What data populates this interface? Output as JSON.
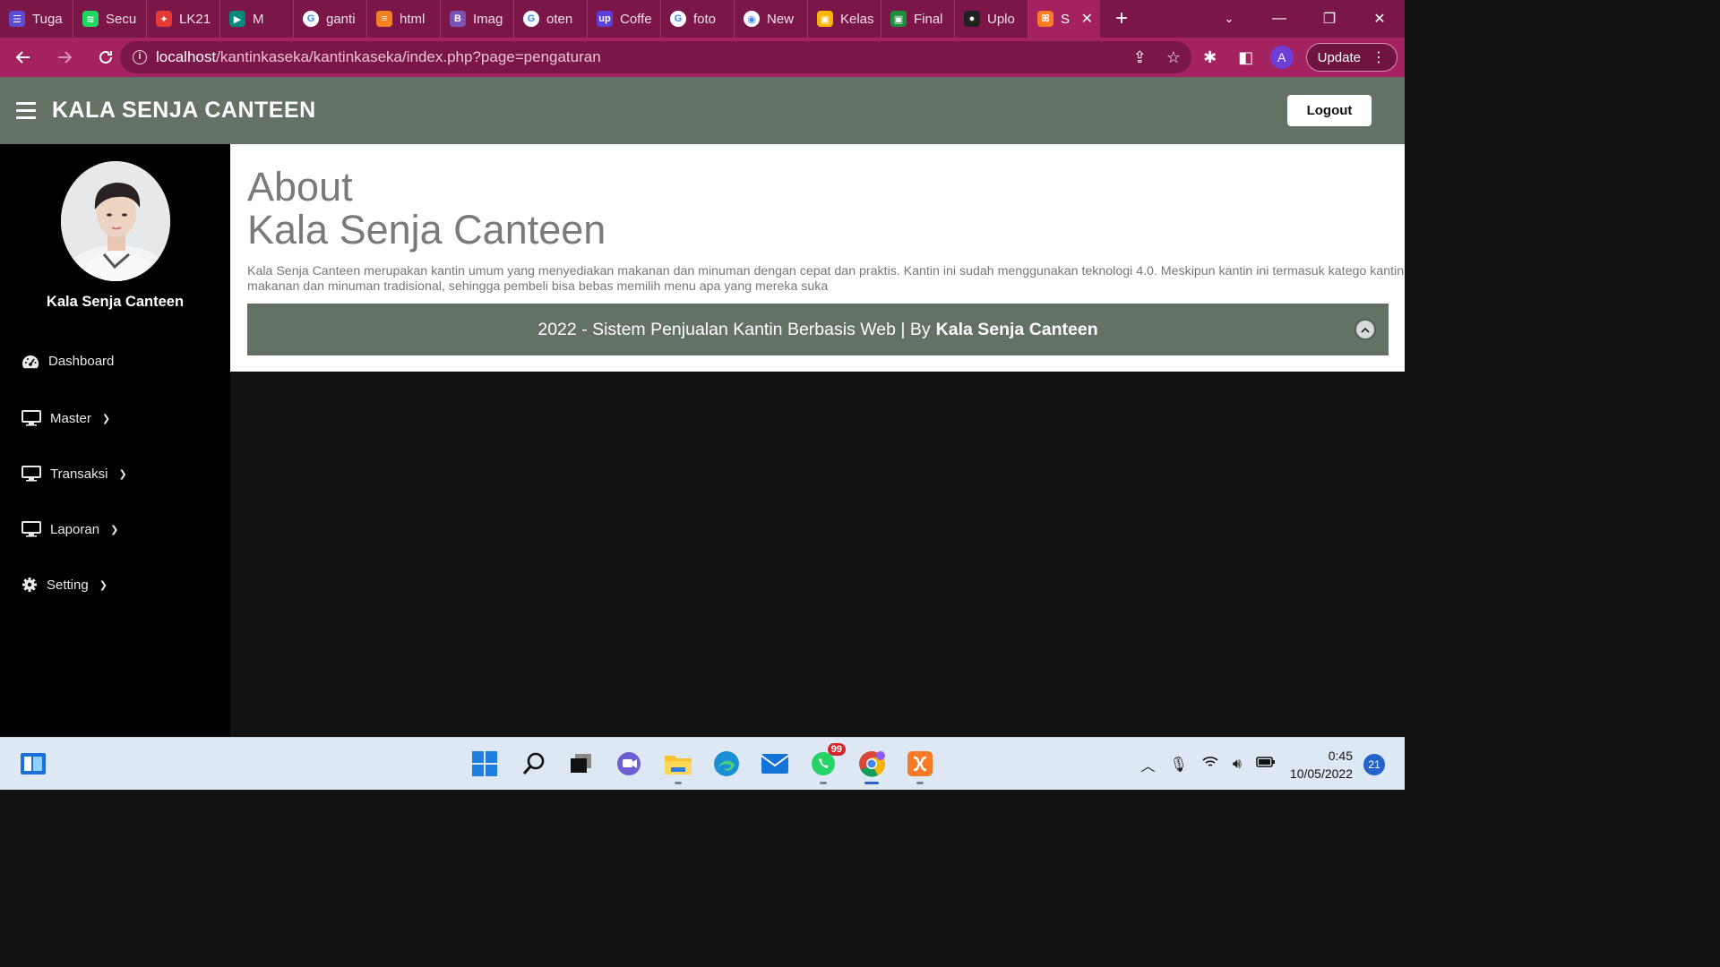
{
  "browser": {
    "tabs": [
      {
        "label": "Tuga",
        "icon": "tasks-icon",
        "color": "#5a4bd1",
        "glyph": "☰"
      },
      {
        "label": "Secu",
        "icon": "spotify-icon",
        "color": "#1ed760",
        "glyph": "≋"
      },
      {
        "label": "LK21",
        "icon": "pinwheel-icon",
        "color": "#e53935",
        "glyph": "✦"
      },
      {
        "label": "M",
        "icon": "meet-icon",
        "color": "#00897b",
        "glyph": "▶"
      },
      {
        "label": "ganti",
        "icon": "google-icon",
        "color": "#ffffff",
        "glyph": "G"
      },
      {
        "label": "html",
        "icon": "stackoverflow-icon",
        "color": "#f48024",
        "glyph": "≡"
      },
      {
        "label": "Imag",
        "icon": "bootstrap-icon",
        "color": "#7952b3",
        "glyph": "B"
      },
      {
        "label": "oten",
        "icon": "google-icon",
        "color": "#ffffff",
        "glyph": "G"
      },
      {
        "label": "Coffe",
        "icon": "upwork-icon",
        "color": "#5b3fd9",
        "glyph": "up"
      },
      {
        "label": "foto",
        "icon": "google-icon",
        "color": "#ffffff",
        "glyph": "G"
      },
      {
        "label": "New",
        "icon": "chrome-icon",
        "color": "#ffffff",
        "glyph": "◉"
      },
      {
        "label": "Kelas",
        "icon": "classroom-icon",
        "color": "#f9b400",
        "glyph": "▣"
      },
      {
        "label": "Final",
        "icon": "classroom-icon",
        "color": "#1e8e3e",
        "glyph": "▣"
      },
      {
        "label": "Uplo",
        "icon": "github-icon",
        "color": "#222222",
        "glyph": "●"
      }
    ],
    "active_tab": {
      "label": "S",
      "icon": "xampp-icon",
      "color": "#fb7a24",
      "glyph": "ꕤ"
    },
    "url_host": "localhost",
    "url_path": "/kantinkaseka/kantinkaseka/index.php?page=pengaturan",
    "update_label": "Update",
    "profile_initial": "A"
  },
  "app": {
    "brand": "KALA SENJA CANTEEN",
    "logout_label": "Logout",
    "profile_name": "Kala Senja Canteen",
    "menu": {
      "dashboard": "Dashboard",
      "master": "Master",
      "transaksi": "Transaksi",
      "laporan": "Laporan",
      "setting": "Setting"
    },
    "about": {
      "title": "About\nKala Senja Canteen",
      "text": "Kala Senja Canteen merupakan kantin umum yang menyediakan makanan dan minuman dengan cepat dan praktis. Kantin ini sudah menggunakan teknologi 4.0. Meskipun kantin ini termasuk katego kantin ini menyediakan makanan dan minuman tradisional, sehingga pembeli bisa bebas memilih menu apa yang mereka suka"
    },
    "footer": {
      "text": "2022 - Sistem Penjualan Kantin Berbasis Web | By",
      "brand": "Kala Senja Canteen"
    },
    "colors": {
      "header": "#647265",
      "sidebar": "#000000"
    }
  },
  "taskbar": {
    "whatsapp_badge": "99",
    "time": "0:45",
    "date": "10/05/2022",
    "notifications": "21"
  }
}
